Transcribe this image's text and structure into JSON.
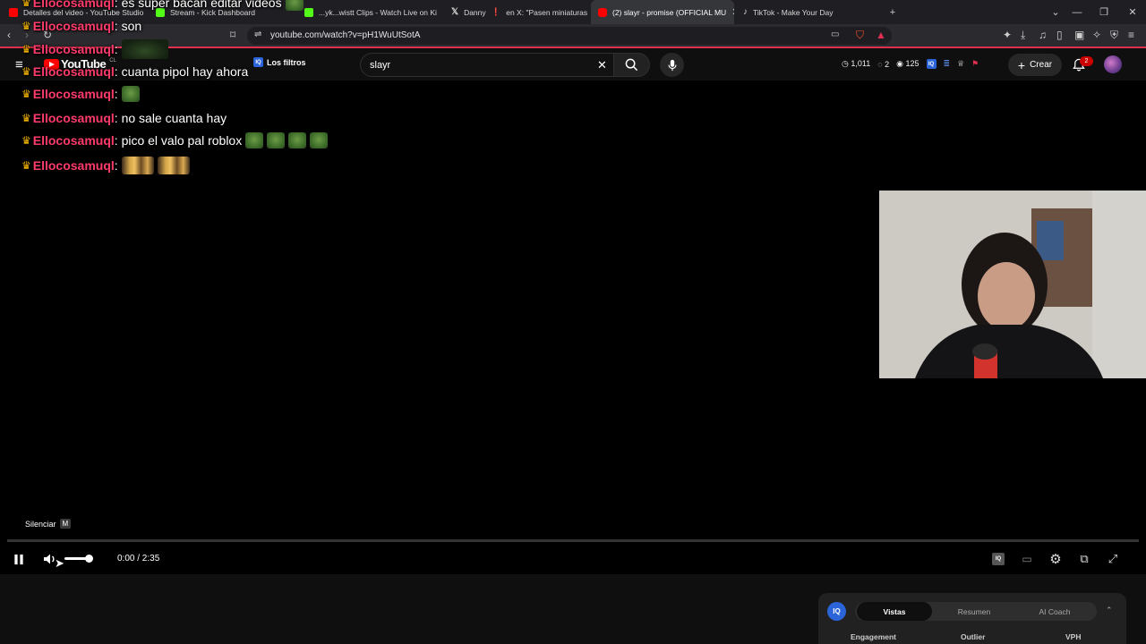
{
  "browser": {
    "tabs": [
      {
        "title": "Detalles del video - YouTube Studio",
        "favicon_color": "#ff0000"
      },
      {
        "title": "Stream - Kick Dashboard",
        "favicon_color": "#53fc18"
      },
      {
        "title": "...yk...wistt Clips - Watch Live on Ki",
        "favicon_color": "#53fc18"
      },
      {
        "title": "Danny",
        "favicon_color": "#ffffff"
      },
      {
        "title": "en X: \"Pasen miniaturas cu",
        "favicon_color": "#ffffff"
      },
      {
        "title": "(2) slayr - promise (OFFICIAL MU",
        "favicon_color": "#ff0000"
      },
      {
        "title": "TikTok - Make Your Day",
        "favicon_color": "#ffffff"
      }
    ],
    "url": "youtube.com/watch?v=pH1WuUtSotA"
  },
  "youtube": {
    "logo_text": "YouTube",
    "country_code": "CL",
    "filters_label": "Los filtros",
    "search_value": "slayr",
    "stats": {
      "clock": "1,011",
      "comments": "2",
      "views": "125"
    },
    "create_label": "Crear",
    "notifications": "2"
  },
  "chat": [
    {
      "user": "Ellocosamuql",
      "text": "es super bacan editar videos",
      "emotes": [
        "pepe"
      ]
    },
    {
      "user": "Ellocosamuql",
      "text": "son",
      "emotes": []
    },
    {
      "user": "Ellocosamuql",
      "text": "",
      "emotes": [
        "pepepic"
      ]
    },
    {
      "user": "Ellocosamuql",
      "text": "cuanta pipol hay ahora",
      "emotes": []
    },
    {
      "user": "Ellocosamuql",
      "text": "",
      "emotes": [
        "pepe"
      ]
    },
    {
      "user": "Ellocosamuql",
      "text": "no sale cuanta hay",
      "emotes": []
    },
    {
      "user": "Ellocosamuql",
      "text": "pico el valo pal roblox",
      "emotes": [
        "pepe",
        "pepe",
        "pepe",
        "pepe"
      ]
    },
    {
      "user": "Ellocosamuql",
      "text": "",
      "emotes": [
        "hands",
        "hands"
      ]
    }
  ],
  "player": {
    "tooltip": "Silenciar",
    "tooltip_key": "M",
    "time": "0:00 / 2:35",
    "progress_fraction": 0.0,
    "volume_fraction": 1.0
  },
  "vidiq": {
    "logo": "IQ",
    "tabs": [
      "Vistas",
      "Resumen",
      "AI Coach"
    ],
    "selected_tab": "Vistas",
    "sections": [
      "Engagement",
      "Outlier",
      "VPH"
    ]
  }
}
